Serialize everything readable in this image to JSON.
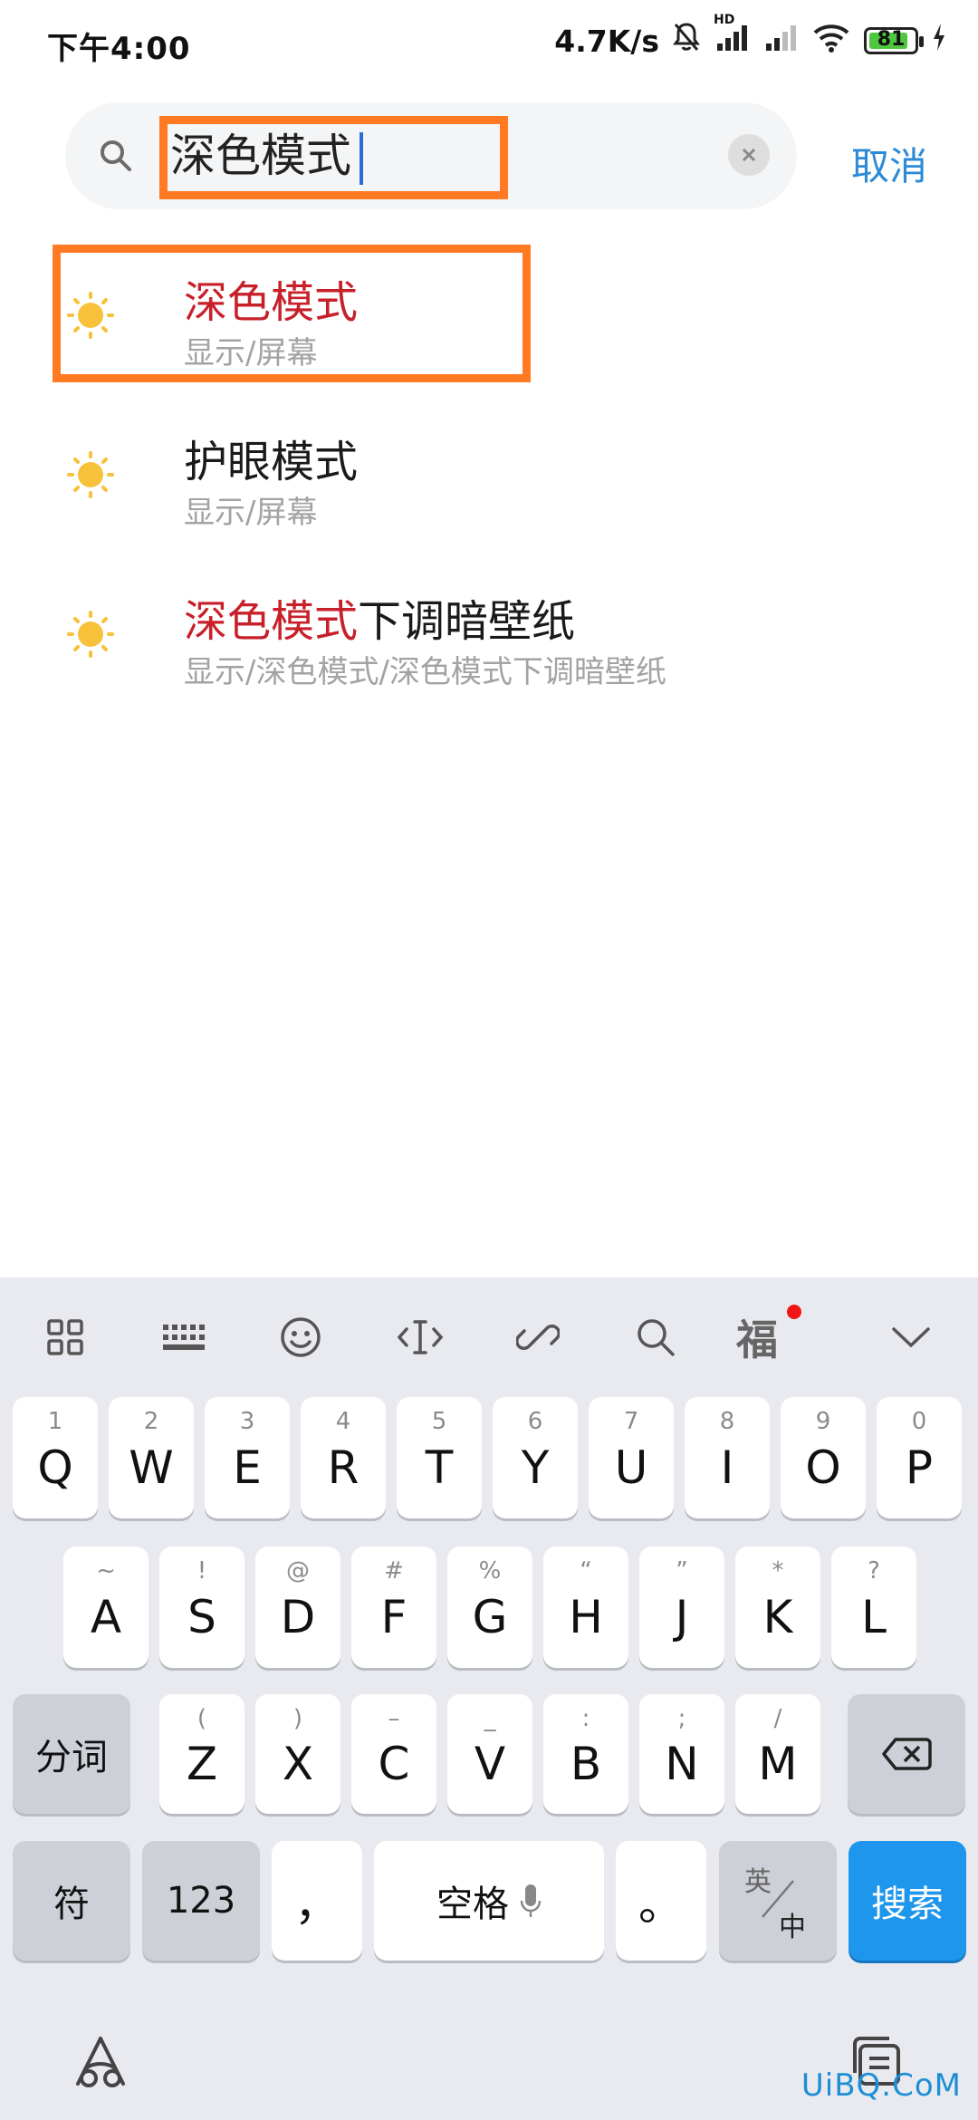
{
  "status": {
    "time": "下午4:00",
    "net_speed": "4.7K/s",
    "signal_hd": "HD",
    "battery": "81"
  },
  "search": {
    "value": "深色模式",
    "cancel_label": "取消"
  },
  "results": [
    {
      "title_hit": "深色模式",
      "title_rest": "",
      "path": "显示/屏幕"
    },
    {
      "title_hit": "",
      "title_rest": "护眼模式",
      "path": "显示/屏幕"
    },
    {
      "title_hit": "深色模式",
      "title_rest": "下调暗壁纸",
      "path": "显示/深色模式/深色模式下调暗壁纸"
    }
  ],
  "keyboard": {
    "toolbar_fu": "福",
    "row1": [
      {
        "key": "Q",
        "hint": "1"
      },
      {
        "key": "W",
        "hint": "2"
      },
      {
        "key": "E",
        "hint": "3"
      },
      {
        "key": "R",
        "hint": "4"
      },
      {
        "key": "T",
        "hint": "5"
      },
      {
        "key": "Y",
        "hint": "6"
      },
      {
        "key": "U",
        "hint": "7"
      },
      {
        "key": "I",
        "hint": "8"
      },
      {
        "key": "O",
        "hint": "9"
      },
      {
        "key": "P",
        "hint": "0"
      }
    ],
    "row2": [
      {
        "key": "A",
        "hint": "~"
      },
      {
        "key": "S",
        "hint": "!"
      },
      {
        "key": "D",
        "hint": "@"
      },
      {
        "key": "F",
        "hint": "#"
      },
      {
        "key": "G",
        "hint": "%"
      },
      {
        "key": "H",
        "hint": "“"
      },
      {
        "key": "J",
        "hint": "”"
      },
      {
        "key": "K",
        "hint": "*"
      },
      {
        "key": "L",
        "hint": "?"
      }
    ],
    "row3": [
      {
        "key": "Z",
        "hint": "("
      },
      {
        "key": "X",
        "hint": ")"
      },
      {
        "key": "C",
        "hint": "–"
      },
      {
        "key": "V",
        "hint": "_"
      },
      {
        "key": "B",
        "hint": ":"
      },
      {
        "key": "N",
        "hint": ";"
      },
      {
        "key": "M",
        "hint": "/"
      }
    ],
    "fenci": "分词",
    "fu": "符",
    "num": "123",
    "comma": "，",
    "space": "空格",
    "period": "。",
    "lang_top": "英",
    "lang_bottom": "中",
    "search_key": "搜索"
  },
  "watermark": "UiBQ.CoM",
  "colors": {
    "accent": "#2c8ad6",
    "highlight": "#ff7a22",
    "hit_text": "#c8202a",
    "search_key": "#1e96ec"
  }
}
